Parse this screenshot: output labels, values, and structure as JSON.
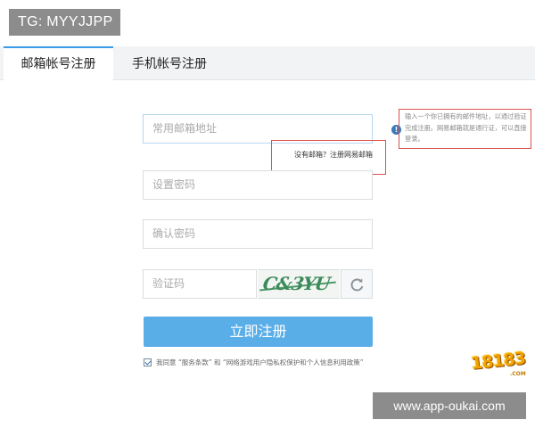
{
  "overlay": {
    "tg_label": "TG: MYYJJPP",
    "watermark_url": "www.app-oukai.com"
  },
  "tabs": [
    {
      "label": "邮箱帐号注册",
      "active": true
    },
    {
      "label": "手机帐号注册",
      "active": false
    }
  ],
  "form": {
    "email_placeholder": "常用邮箱地址",
    "password_placeholder": "设置密码",
    "confirm_placeholder": "确认密码",
    "captcha_placeholder": "验证码",
    "captcha_image_text": "C&3YU",
    "no_email_hint": "没有邮箱？注册网易邮箱",
    "email_tip": "输入一个你已拥有的邮件地址，以通过验证完成注册。网易邮箱就是通行证，可以直接登录。",
    "submit_label": "立即注册",
    "agree_checked": true,
    "agree_text": "我同意 “服务条款” 和 “网络游戏用户隐私权保护和个人信息利用政策”"
  },
  "logo": {
    "brand": "18183",
    "sub": ".COM"
  },
  "colors": {
    "accent": "#5aaee8",
    "tab_active_border": "#3b9be6",
    "highlight_box": "#d9534f",
    "overlay_gray": "#8c8c8c"
  }
}
